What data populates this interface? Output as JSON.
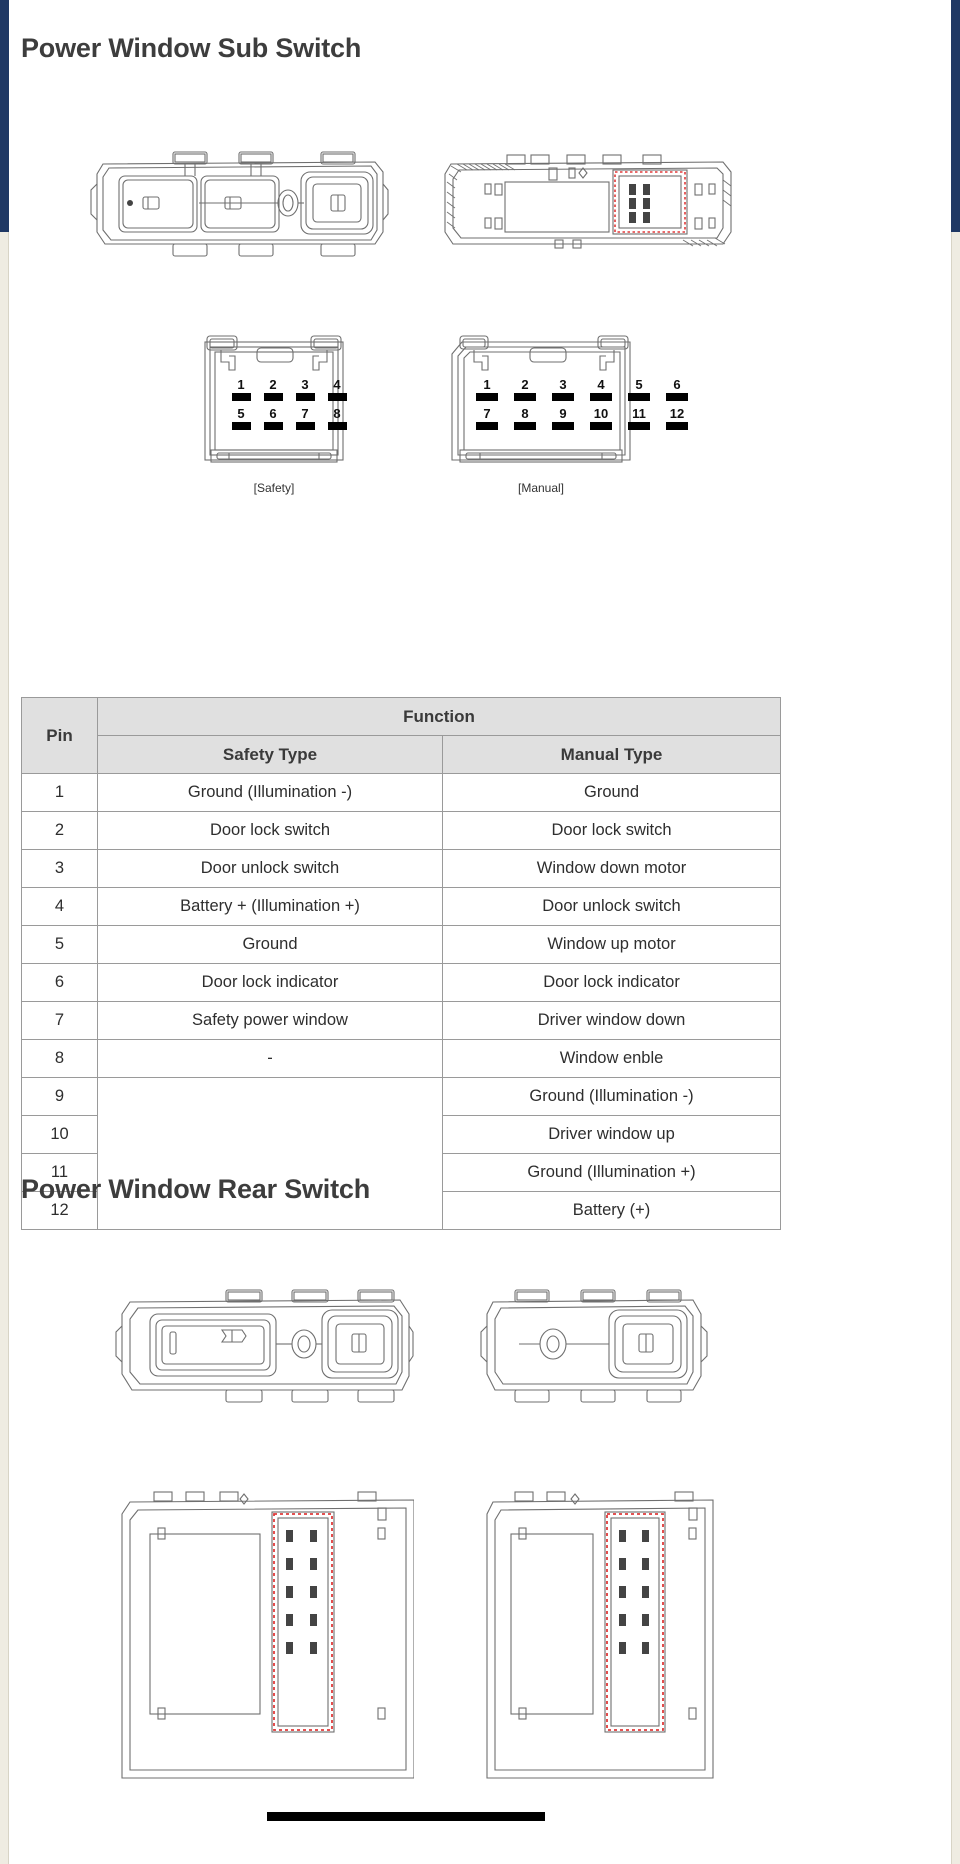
{
  "document": {
    "sections": [
      {
        "id": "sub-switch",
        "heading": "Power Window Sub Switch"
      },
      {
        "id": "rear-switch",
        "heading": "Power Window Rear Switch"
      }
    ]
  },
  "sub_switch": {
    "figures": {
      "front_view_label": "switch-front-view",
      "rear_view_label": "switch-rear-view-with-connector"
    },
    "connectors": [
      {
        "caption": "[Safety]",
        "pin_count": 8,
        "rows": [
          [
            "1",
            "2",
            "3",
            "4"
          ],
          [
            "5",
            "6",
            "7",
            "8"
          ]
        ]
      },
      {
        "caption": "[Manual]",
        "pin_count": 12,
        "rows": [
          [
            "1",
            "2",
            "3",
            "4",
            "5",
            "6"
          ],
          [
            "7",
            "8",
            "9",
            "10",
            "11",
            "12"
          ]
        ]
      }
    ],
    "table": {
      "headers": {
        "pin": "Pin",
        "function": "Function",
        "safety_type": "Safety Type",
        "manual_type": "Manual Type"
      },
      "rows": [
        {
          "pin": "1",
          "safety": "Ground (Illumination -)",
          "manual": "Ground"
        },
        {
          "pin": "2",
          "safety": "Door lock switch",
          "manual": "Door lock switch"
        },
        {
          "pin": "3",
          "safety": "Door unlock switch",
          "manual": "Window down motor"
        },
        {
          "pin": "4",
          "safety": "Battery + (Illumination +)",
          "manual": "Door unlock switch"
        },
        {
          "pin": "5",
          "safety": "Ground",
          "manual": "Window up motor"
        },
        {
          "pin": "6",
          "safety": "Door lock indicator",
          "manual": "Door lock indicator"
        },
        {
          "pin": "7",
          "safety": "Safety power window",
          "manual": "Driver window down"
        },
        {
          "pin": "8",
          "safety": "-",
          "manual": "Window enble"
        },
        {
          "pin": "9",
          "safety": "",
          "manual": "Ground (Illumination -)"
        },
        {
          "pin": "10",
          "safety": "",
          "manual": "Driver window up"
        },
        {
          "pin": "11",
          "safety": "",
          "manual": "Ground (Illumination +)"
        },
        {
          "pin": "12",
          "safety": "",
          "manual": "Battery (+)"
        }
      ]
    }
  },
  "rear_switch": {
    "figures": {
      "left_view_label": "rear-switch-front-view",
      "right_view_label": "rear-switch-front-view-alt",
      "left_connector_label": "rear-switch-connector-left",
      "right_connector_label": "rear-switch-connector-right"
    }
  },
  "colors": {
    "page_background": "#ffffff",
    "edge_navy": "#1f3864",
    "edge_paper": "#efece2",
    "heading_text": "#3d3d3d",
    "table_header_fill": "#e0e0e0",
    "table_border": "#9a9a9a",
    "table_text": "#2e2e2e",
    "pin_blade": "#000000",
    "connector_highlight": "#e03a3a",
    "drawing_line": "#6f6f6f"
  }
}
